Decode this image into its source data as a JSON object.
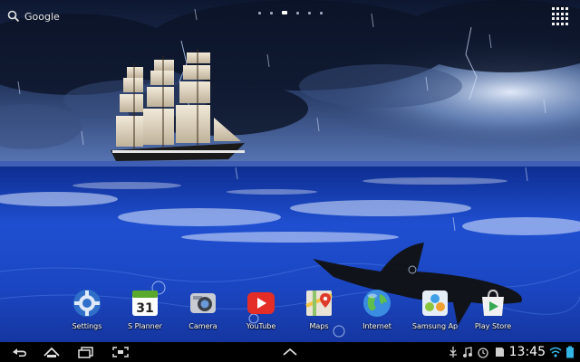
{
  "search": {
    "label": "Google"
  },
  "home_pages": {
    "count": 6,
    "active": 3
  },
  "dock_apps": [
    {
      "label": "Settings",
      "icon": "settings-icon"
    },
    {
      "label": "S Planner",
      "icon": "calendar-icon",
      "badge": "31"
    },
    {
      "label": "Camera",
      "icon": "camera-icon"
    },
    {
      "label": "YouTube",
      "icon": "youtube-icon"
    },
    {
      "label": "Maps",
      "icon": "maps-icon"
    },
    {
      "label": "Internet",
      "icon": "globe-icon"
    },
    {
      "label": "Samsung Ap",
      "icon": "samsung-apps-icon"
    },
    {
      "label": "Play Store",
      "icon": "play-store-icon"
    }
  ],
  "status": {
    "time": "13:45"
  },
  "colors": {
    "accent": "#33b5e5",
    "sky": "#1b2a4a",
    "sea": "#1a4fd6"
  }
}
